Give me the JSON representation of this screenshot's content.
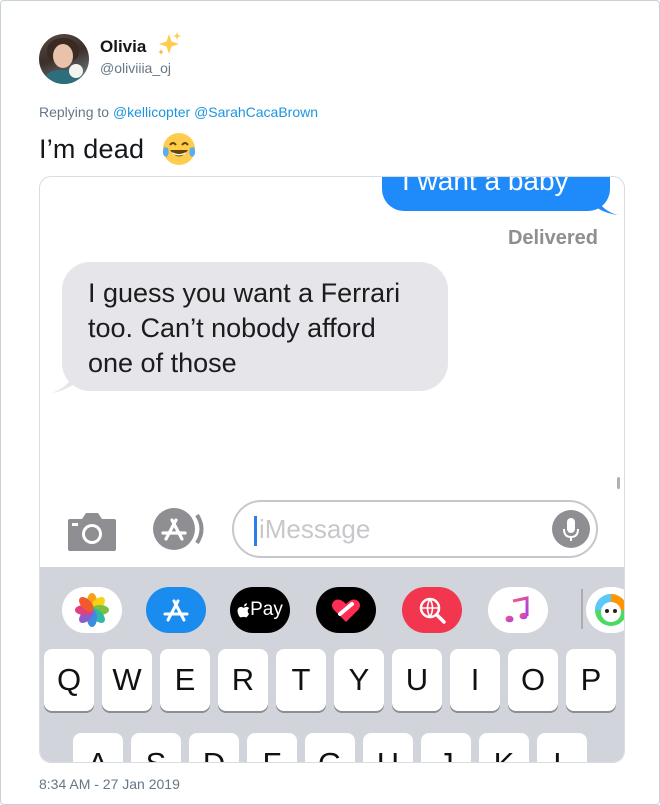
{
  "tweet": {
    "display_name": "Olivia",
    "handle": "@oliviiia_oj",
    "replying_prefix": "Replying to",
    "mentions": [
      "@kellicopter",
      "@SarahCacaBrown"
    ],
    "text": "I’m dead",
    "timestamp": "8:34 AM - 27 Jan 2019",
    "name_emoji_icon": "sparkles-icon",
    "text_emoji_icon": "face-with-tears-of-joy-icon"
  },
  "screenshot": {
    "outgoing_message": "I want a baby",
    "status": "Delivered",
    "incoming_message_lines": [
      "I guess you want a Ferrari",
      "too. Can’t nobody afford",
      "one of those"
    ],
    "input_placeholder": "iMessage",
    "apps": [
      {
        "name": "photos-app-icon",
        "bg": "#ffffff"
      },
      {
        "name": "app-store-icon",
        "bg": "#1a8cf0"
      },
      {
        "name": "apple-pay-icon",
        "bg": "#000000",
        "label": "Pay"
      },
      {
        "name": "digital-touch-icon",
        "bg": "#000000"
      },
      {
        "name": "web-search-icon",
        "bg": "#f2364e"
      },
      {
        "name": "music-app-icon",
        "bg": "#ffffff"
      },
      {
        "name": "game-app-icon",
        "bg": "#ffffff"
      }
    ],
    "keyboard_row1": [
      "Q",
      "W",
      "E",
      "R",
      "T",
      "Y",
      "U",
      "I",
      "O",
      "P"
    ],
    "keyboard_row2": [
      "A",
      "S",
      "D",
      "F",
      "G",
      "H",
      "J",
      "K",
      "L"
    ]
  },
  "colors": {
    "mention": "#1b95e0",
    "imessage_blue": "#1f8bfa",
    "incoming_gray": "#e5e5ea",
    "keyboard_bg": "#d1d4da"
  }
}
